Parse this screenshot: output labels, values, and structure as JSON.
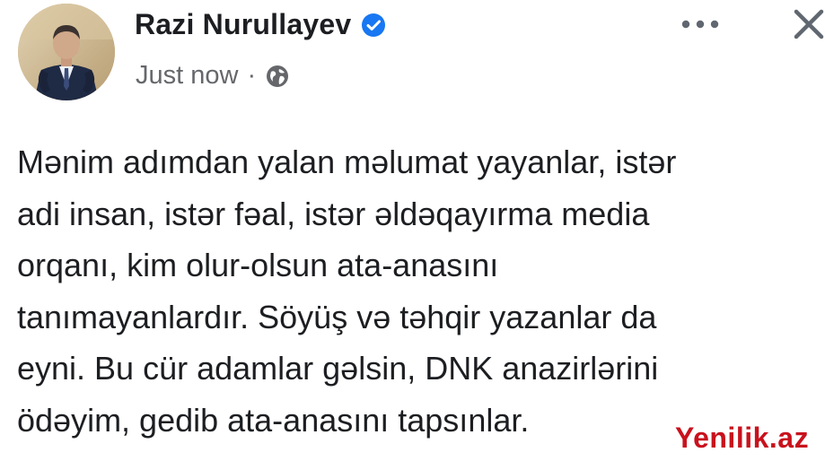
{
  "post": {
    "author": {
      "name": "Razi Nurullayev",
      "verified": true,
      "avatar_icon": "profile-photo"
    },
    "meta": {
      "timestamp": "Just now",
      "separator": "·",
      "audience_icon": "globe-icon"
    },
    "actions": {
      "more_icon": "more-horizontal-icon",
      "close_icon": "close-icon"
    },
    "text": "Mənim adımdan yalan məlumat yayanlar, istər\nadi insan, istər fəal, istər əldəqayırma media\norqanı, kim olur-olsun ata-anasını\ntanımayanlardır. Söyüş və təhqir yazanlar da\neyni. Bu cür adamlar gəlsin, DNK anazirlərini\nödəyim, gedib ata-anasını tapsınlar."
  },
  "watermark": {
    "text": "Yenilik.az",
    "color": "#c8121d"
  },
  "colors": {
    "verified_blue": "#1877f2",
    "meta_gray": "#65676b",
    "text": "#1c1e21"
  }
}
